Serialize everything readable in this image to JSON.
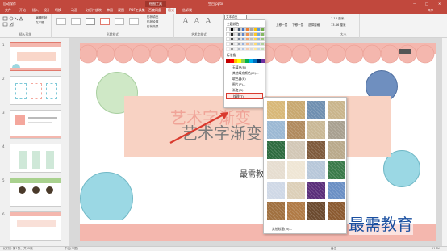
{
  "titlebar": {
    "autosave": "自动保存",
    "filename": "空白.pptx",
    "tool_tab": "绘图工具",
    "min": "—",
    "max": "□",
    "close": "✕"
  },
  "tabs": [
    "文件",
    "开始",
    "插入",
    "设计",
    "切换",
    "动画",
    "幻灯片放映",
    "审阅",
    "视图",
    "PDF工具集",
    "百度网盘",
    "格式",
    "告诉我"
  ],
  "active_tab": "格式",
  "ribbon": {
    "groups": [
      {
        "label": "插入形状"
      },
      {
        "label": "形状样式"
      },
      {
        "label": "艺术字样式"
      },
      {
        "label": "大小"
      }
    ],
    "edit_shape": "编辑形状",
    "text_box": "文本框",
    "shape_fill": "形状填充",
    "shape_outline": "形状轮廓",
    "shape_effect": "形状效果",
    "text_fill": "文本填充",
    "bring_forward": "上移一层",
    "send_backward": "下移一层",
    "selection_pane": "选择窗格",
    "height": "1.16 厘米",
    "width": "13.46 厘米",
    "share": "共享"
  },
  "thumbnails": [
    {
      "num": "1"
    },
    {
      "num": "2"
    },
    {
      "num": "3"
    },
    {
      "num": "4"
    },
    {
      "num": "5"
    },
    {
      "num": "6"
    }
  ],
  "slide": {
    "wordart_pink": "艺术字渐变",
    "wordart_grey": "艺术字渐变",
    "subtitle": "最需教"
  },
  "color_menu": {
    "theme_colors": "主题颜色",
    "standard_colors": "标准色",
    "no_fill": "无填充(N)",
    "more_colors": "其他填充颜色(M)...",
    "eyedropper": "取色器(E)",
    "picture": "图片(P)...",
    "gradient": "渐变(G)",
    "texture": "纹理(T)",
    "theme_palette": [
      "#ffffff",
      "#000000",
      "#e7e6e6",
      "#44546a",
      "#4472c4",
      "#ed7d31",
      "#a5a5a5",
      "#ffc000",
      "#5b9bd5",
      "#70ad47"
    ],
    "standard_palette": [
      "#c00000",
      "#ff0000",
      "#ffc000",
      "#ffff00",
      "#92d050",
      "#00b050",
      "#00b0f0",
      "#0070c0",
      "#002060",
      "#7030a0"
    ]
  },
  "texture_menu": {
    "more_textures": "其他纹理(M)...",
    "textures": [
      "#d8b878",
      "#c8a870",
      "#6f8fb0",
      "#c9b58c",
      "#9bb8d3",
      "#b08a5e",
      "#c9b896",
      "#a8a090",
      "#2e6b3f",
      "#d2c7b6",
      "#7e5a3c",
      "#b9a98b",
      "#e6ddd0",
      "#efe6d5",
      "#b7c7d9",
      "#3a7a4a",
      "#cfd8e6",
      "#dccfb8",
      "#5a2e7a",
      "#6a8fc4",
      "#a0703f",
      "#b07a45",
      "#6b4a2e",
      "#8b5a30"
    ]
  },
  "status": {
    "slide_info": "幻灯片 第1张，共25张",
    "lang": "中文(中国)",
    "notes": "备注",
    "zoom": "115%"
  },
  "watermark": "最需教育"
}
